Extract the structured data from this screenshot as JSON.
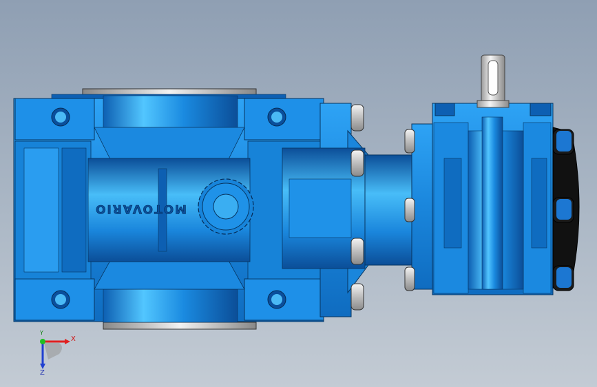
{
  "model": {
    "housing_engraving": "MOTOVARIO"
  },
  "triad": {
    "x_label": "X",
    "y_label": "Y",
    "z_label": "Z"
  },
  "colors": {
    "viewport_top": "#8f9fb3",
    "viewport_bottom": "#c3cbd4",
    "part_blue": "#1e8fe6",
    "part_dark": "#0a4f9c",
    "part_light": "#5cc2ff",
    "bolt": "#d8d8d8",
    "seal": "#101010",
    "axis_x": "#e02020",
    "axis_y": "#20c020",
    "axis_z": "#2040d0"
  }
}
